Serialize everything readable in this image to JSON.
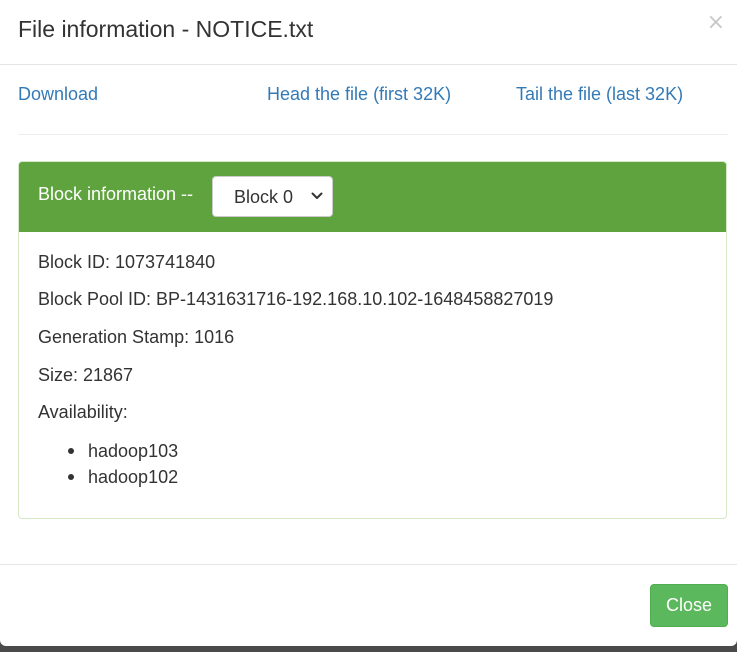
{
  "modal": {
    "title": "File information - NOTICE.txt",
    "close_symbol": "×"
  },
  "links": {
    "download": "Download",
    "head": "Head the file (first 32K)",
    "tail": "Tail the file (last 32K)"
  },
  "block_panel": {
    "heading_label": "Block information --",
    "selected_block": "Block 0",
    "lines": {
      "block_id": "Block ID: 1073741840",
      "block_pool_id": "Block Pool ID: BP-1431631716-192.168.10.102-1648458827019",
      "generation_stamp": "Generation Stamp: 1016",
      "size": "Size: 21867",
      "availability": "Availability:"
    },
    "availability_hosts": [
      "hadoop103",
      "hadoop102"
    ]
  },
  "footer": {
    "close_label": "Close"
  },
  "colors": {
    "panel_heading": "#5fa33e",
    "link": "#337ab7",
    "close_button": "#5cb85c"
  },
  "icons": {
    "close": "close-icon",
    "dropdown": "chevron-down-icon"
  }
}
